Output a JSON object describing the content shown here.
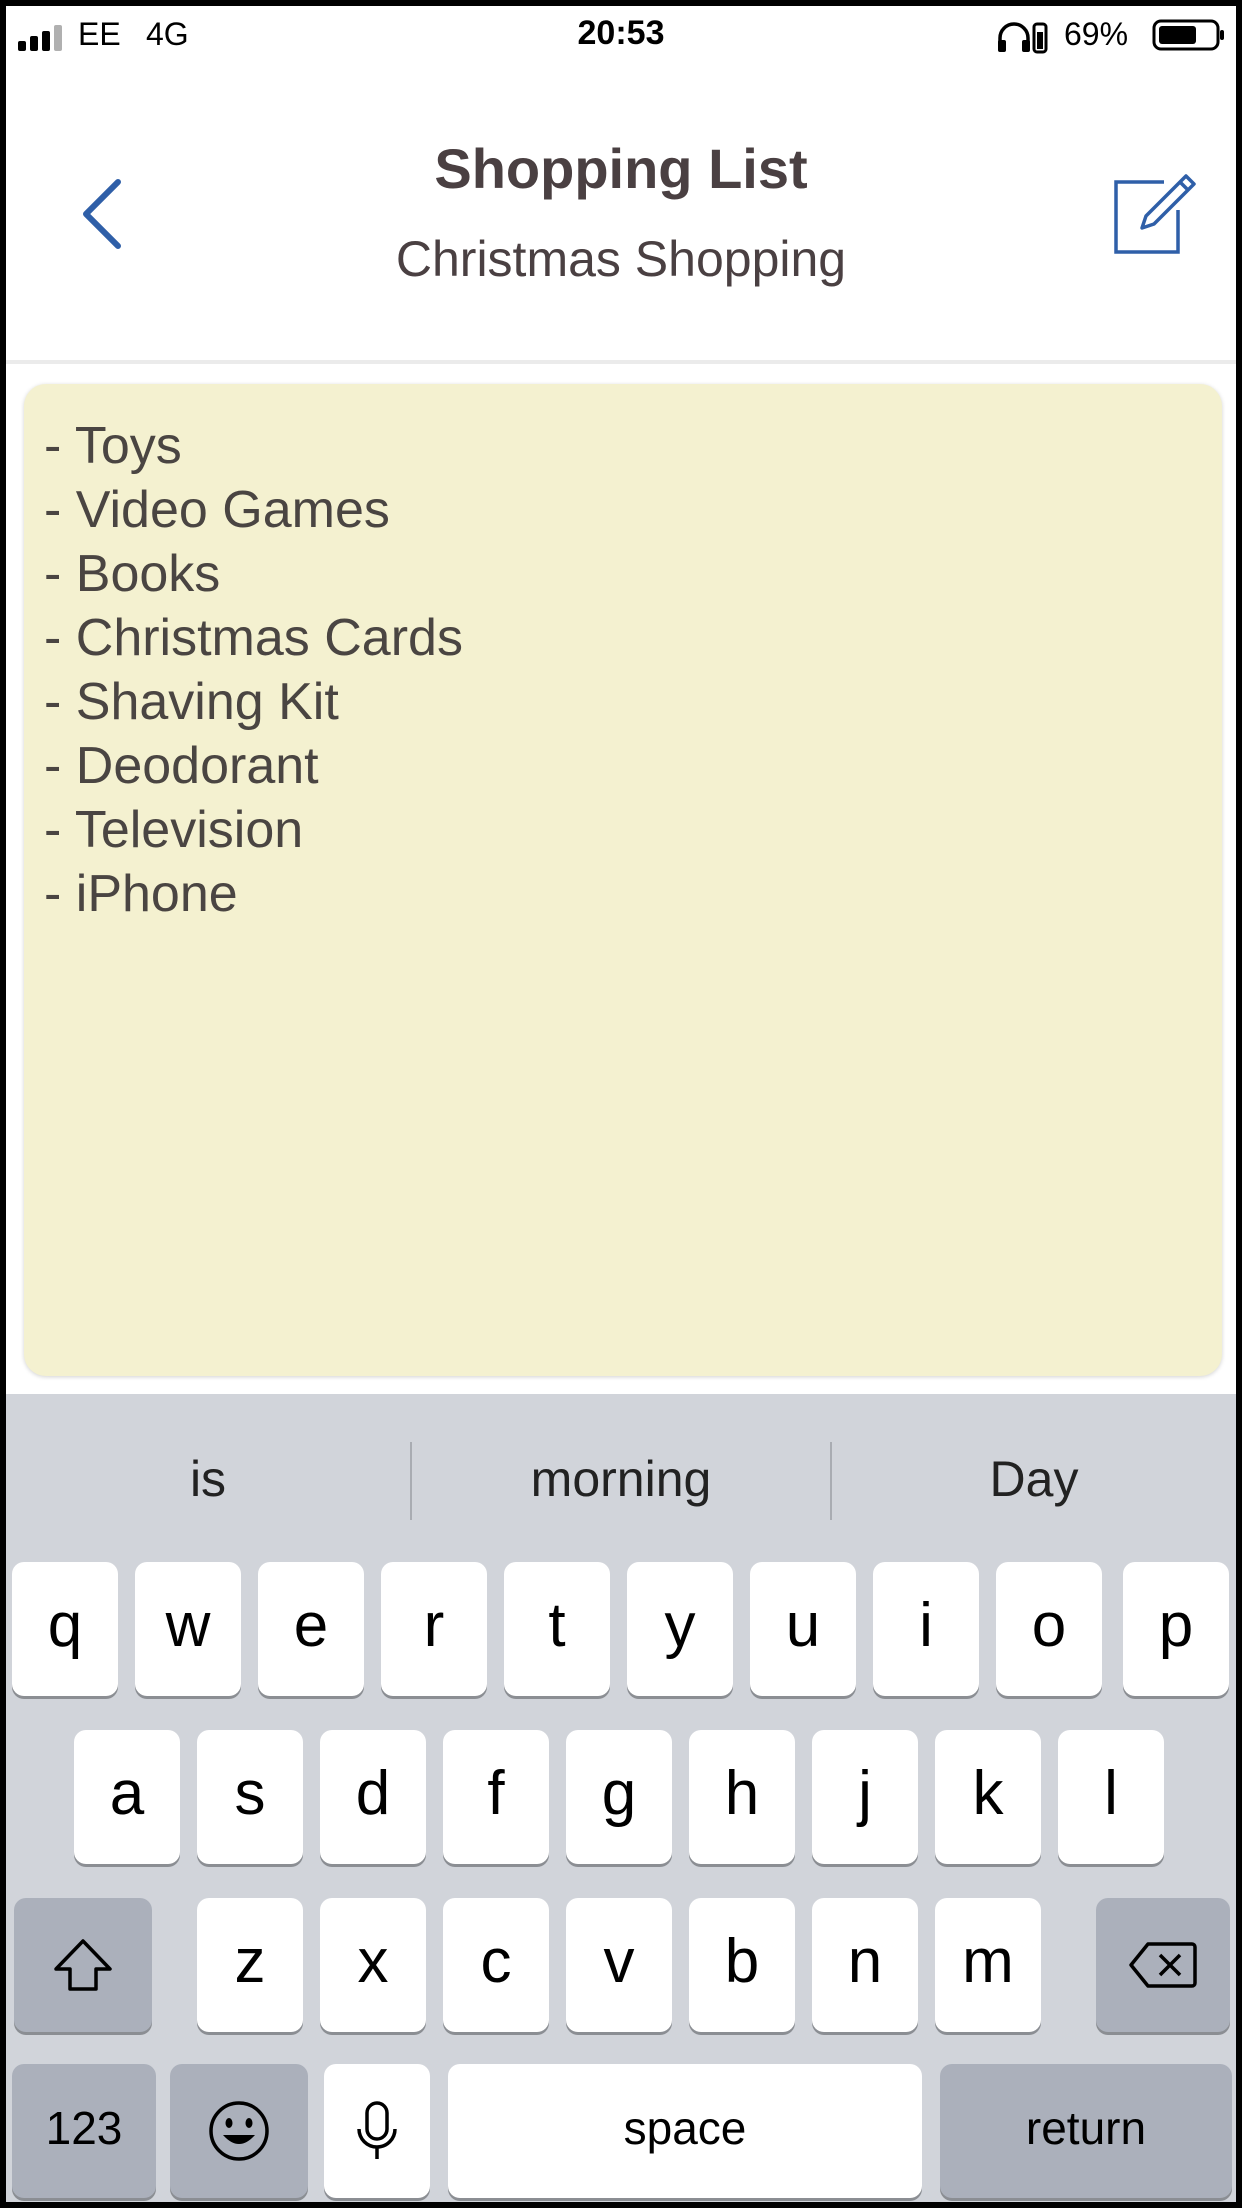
{
  "status_bar": {
    "carrier": "EE",
    "network": "4G",
    "time": "20:53",
    "battery_percent": "69%",
    "battery_level": 0.69
  },
  "nav": {
    "title": "Shopping List",
    "subtitle": "Christmas Shopping",
    "back_icon": "chevron-left-icon",
    "edit_icon": "compose-icon",
    "accent_color": "#2f5fa8"
  },
  "note": {
    "background": "#f4f1d0",
    "lines": [
      "- Toys",
      "- Video Games",
      "- Books",
      "- Christmas Cards",
      "- Shaving Kit",
      "- Deodorant",
      "- Television",
      "- iPhone"
    ]
  },
  "keyboard": {
    "suggestions": [
      "is",
      "morning",
      "Day"
    ],
    "row1": [
      "q",
      "w",
      "e",
      "r",
      "t",
      "y",
      "u",
      "i",
      "o",
      "p"
    ],
    "row2": [
      "a",
      "s",
      "d",
      "f",
      "g",
      "h",
      "j",
      "k",
      "l"
    ],
    "row3": [
      "z",
      "x",
      "c",
      "v",
      "b",
      "n",
      "m"
    ],
    "numbers_label": "123",
    "space_label": "space",
    "return_label": "return",
    "shift_icon": "shift-arrow-icon",
    "delete_icon": "backspace-icon",
    "emoji_icon": "emoji-icon",
    "mic_icon": "microphone-icon"
  }
}
